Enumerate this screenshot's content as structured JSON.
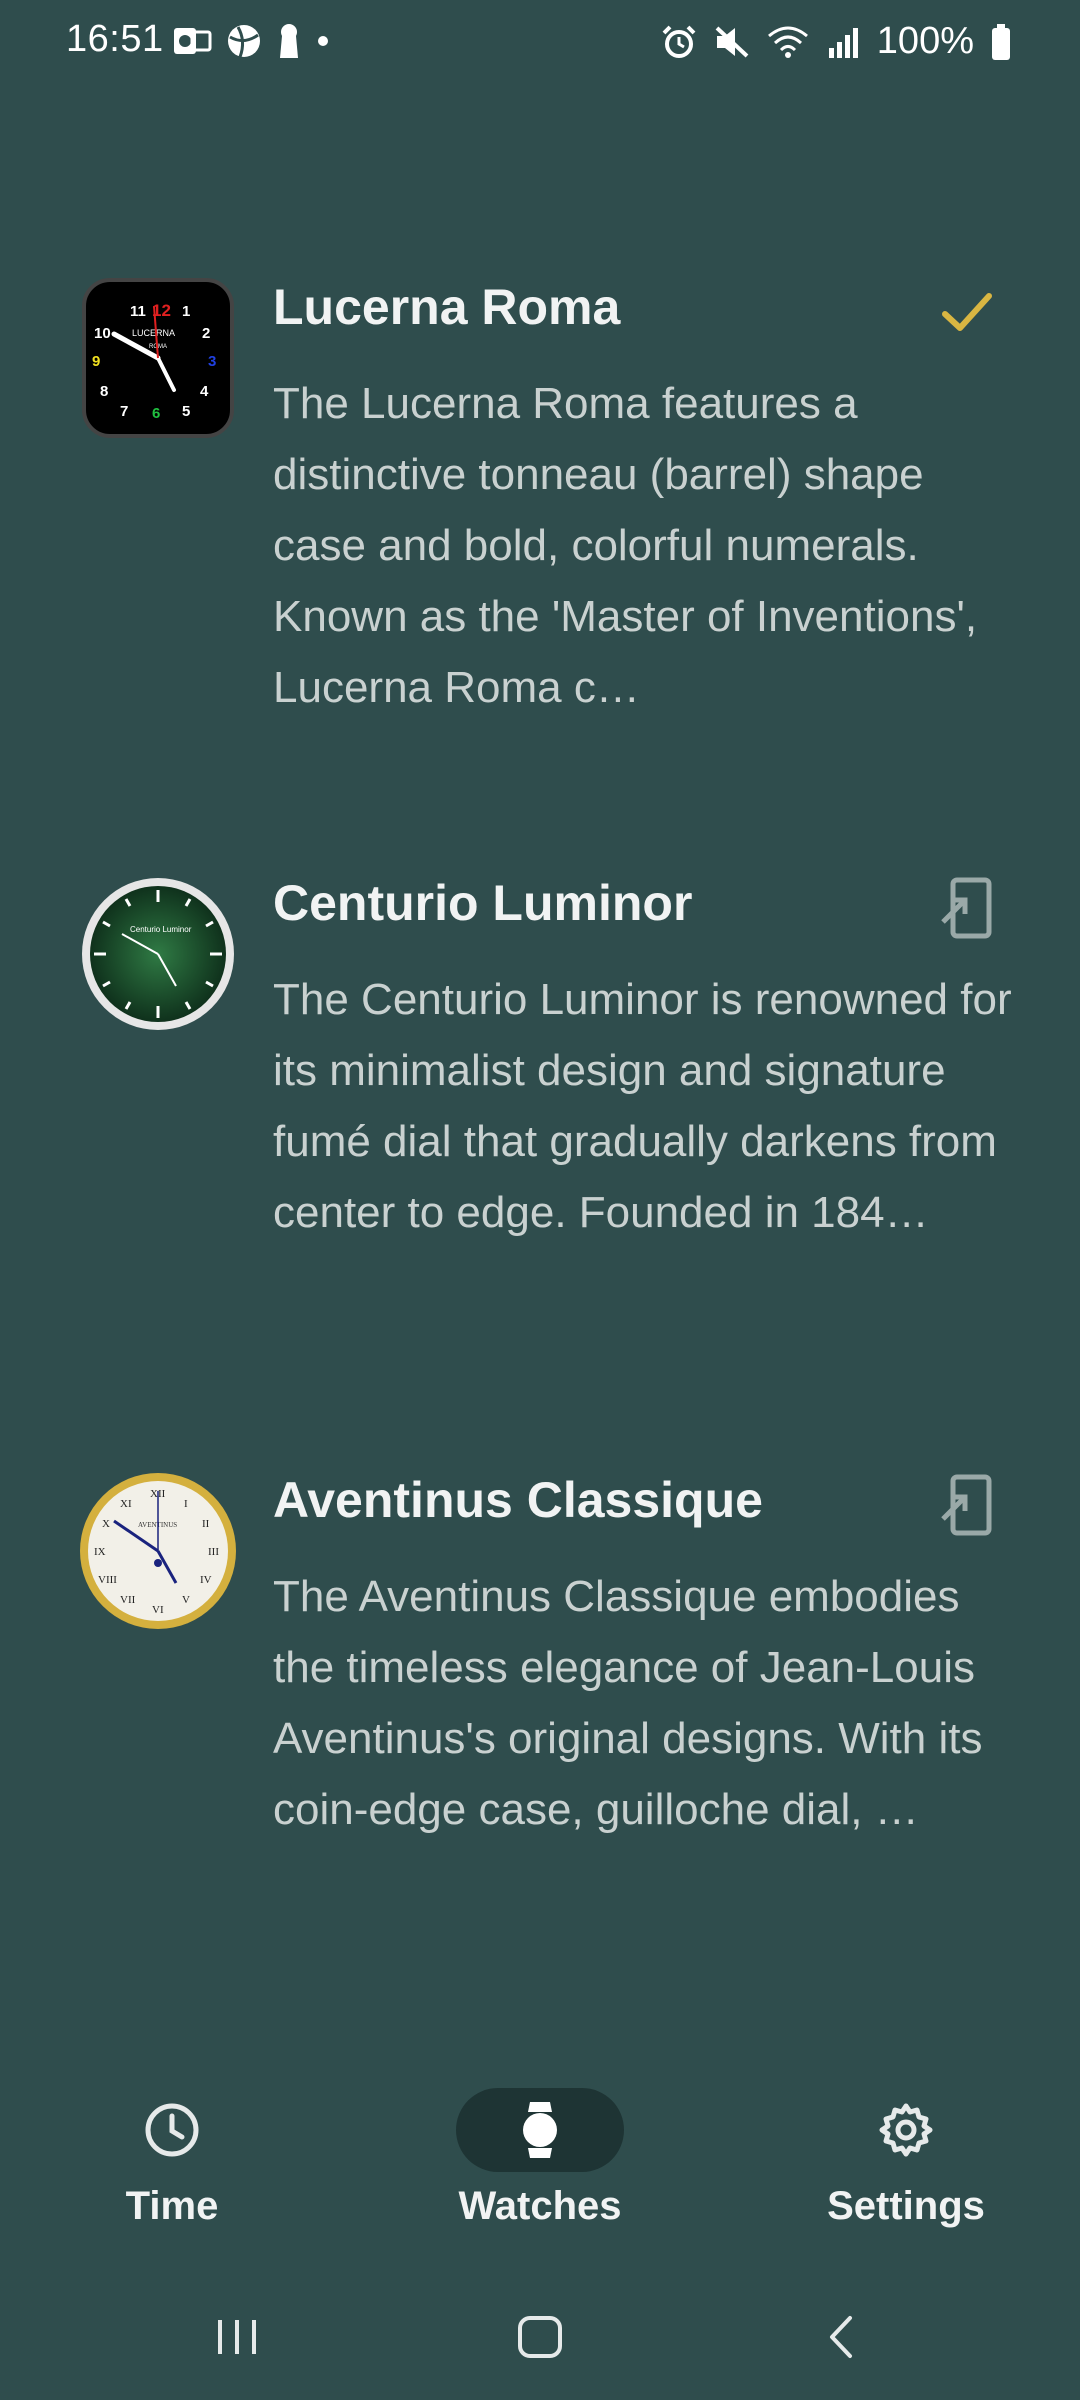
{
  "status_bar": {
    "time": "16:51",
    "battery": "100%"
  },
  "watches": [
    {
      "title": "Lucerna Roma",
      "description": "The Lucerna Roma features a distinctive tonneau (barrel) shape case and bold, colorful numerals. Known as the 'Master of Inventions', Lucerna Roma c…",
      "status": "selected",
      "face_brand": "LUCERNA",
      "face_sub": "ROMA",
      "face_numerals": [
        "11",
        "12",
        "1",
        "2",
        "3",
        "4",
        "5",
        "6",
        "7",
        "8",
        "9",
        "10"
      ]
    },
    {
      "title": "Centurio Luminor",
      "description": "The Centurio Luminor is renowned for its minimalist design and signature fumé dial that gradually darkens from center to edge. Founded in 184…",
      "status": "apply",
      "face_brand": "Centurio Luminor"
    },
    {
      "title": "Aventinus Classique",
      "description": "The Aventinus Classique embodies the timeless elegance of Jean-Louis Aventinus's original designs. With its coin-edge case, guilloche dial, …",
      "status": "apply",
      "face_brand": "AVENTINUS",
      "face_numerals": [
        "XII",
        "I",
        "II",
        "III",
        "IV",
        "V",
        "VI",
        "VII",
        "VIII",
        "IX",
        "X",
        "XI"
      ]
    }
  ],
  "nav": {
    "time_label": "Time",
    "watches_label": "Watches",
    "settings_label": "Settings",
    "active": "watches"
  },
  "colors": {
    "background": "#2f4d4d",
    "accent_check": "#d9b642",
    "active_pill": "#1e3434"
  }
}
